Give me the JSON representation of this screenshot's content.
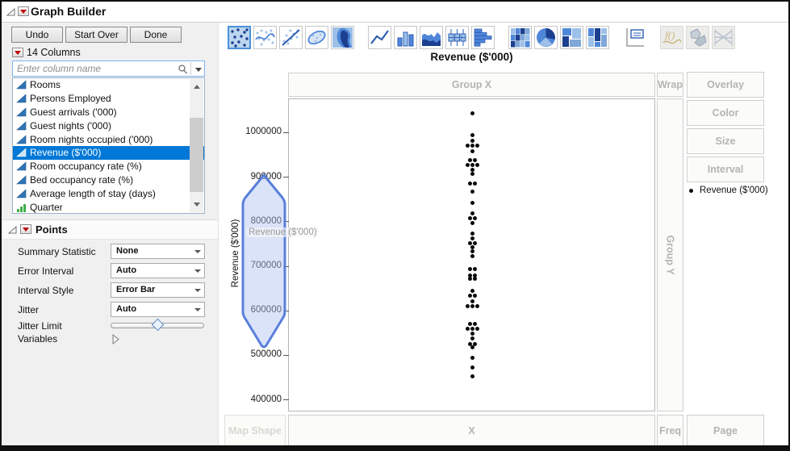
{
  "window": {
    "title": "Graph Builder"
  },
  "toolbar_buttons": {
    "undo": "Undo",
    "start_over": "Start Over",
    "done": "Done"
  },
  "columns": {
    "header": "14 Columns",
    "search_placeholder": "Enter column name",
    "items": [
      {
        "label": "Rooms",
        "type": "continuous",
        "selected": false
      },
      {
        "label": "Persons Employed",
        "type": "continuous",
        "selected": false
      },
      {
        "label": "Guest arrivals ('000)",
        "type": "continuous",
        "selected": false
      },
      {
        "label": "Guest nights ('000)",
        "type": "continuous",
        "selected": false
      },
      {
        "label": "Room nights occupied ('000)",
        "type": "continuous",
        "selected": false
      },
      {
        "label": "Revenue ($'000)",
        "type": "continuous",
        "selected": true
      },
      {
        "label": "Room occupancy rate (%)",
        "type": "continuous",
        "selected": false
      },
      {
        "label": "Bed occupancy rate (%)",
        "type": "continuous",
        "selected": false
      },
      {
        "label": "Average length of stay (days)",
        "type": "continuous",
        "selected": false
      },
      {
        "label": "Quarter",
        "type": "ordinal",
        "selected": false
      }
    ]
  },
  "points_panel": {
    "title": "Points",
    "rows": [
      {
        "label": "Summary Statistic",
        "value": "None"
      },
      {
        "label": "Error Interval",
        "value": "Auto"
      },
      {
        "label": "Interval Style",
        "value": "Error Bar"
      },
      {
        "label": "Jitter",
        "value": "Auto"
      },
      {
        "label": "Jitter Limit",
        "slider_position": 0.5
      },
      {
        "label": "Variables"
      }
    ]
  },
  "toolbar_icons": [
    {
      "name": "points",
      "selected": true
    },
    {
      "name": "smoother"
    },
    {
      "name": "line-of-fit"
    },
    {
      "name": "ellipse"
    },
    {
      "name": "contour"
    },
    {
      "name": "line"
    },
    {
      "name": "bar"
    },
    {
      "name": "area"
    },
    {
      "name": "box-plot"
    },
    {
      "name": "histogram"
    },
    {
      "name": "heatmap"
    },
    {
      "name": "pie"
    },
    {
      "name": "treemap"
    },
    {
      "name": "mosaic"
    },
    {
      "name": "caption-box",
      "plain": true
    },
    {
      "name": "formula",
      "disabled": true
    },
    {
      "name": "map-shapes",
      "disabled": true
    },
    {
      "name": "parallel",
      "disabled": true
    }
  ],
  "drop_zones": {
    "group_x": "Group X",
    "wrap": "Wrap",
    "overlay": "Overlay",
    "color": "Color",
    "size": "Size",
    "interval": "Interval",
    "group_y": "Group Y",
    "map_shape": "Map Shape",
    "x": "X",
    "freq": "Freq",
    "page": "Page"
  },
  "legend": {
    "marker": "dot",
    "label": "Revenue ($'000)"
  },
  "colors": {
    "selection_blue": "#0078d7",
    "drop_highlight_border": "#5a7fdb",
    "drop_highlight_fill": "rgba(173,193,239,0.45)",
    "icon_blue_dark": "#1c3f8f",
    "icon_blue_mid": "#4f86d9",
    "icon_blue_light": "#9dc0e8"
  },
  "chart_data": {
    "type": "scatter",
    "title": "Revenue ($'000)",
    "ylabel": "Revenue ($'000)",
    "drag_label": "Revenue ($'000)",
    "ylim": [
      373000,
      1076000
    ],
    "yticks": [
      400000,
      500000,
      600000,
      700000,
      800000,
      900000,
      1000000
    ],
    "grid": false,
    "point_format": [
      "value",
      "jitter_px"
    ],
    "points": [
      [
        1045000,
        0
      ],
      [
        995000,
        0
      ],
      [
        982000,
        0
      ],
      [
        971000,
        -6
      ],
      [
        971000,
        0
      ],
      [
        971000,
        6
      ],
      [
        960000,
        0
      ],
      [
        940000,
        -3
      ],
      [
        940000,
        3
      ],
      [
        929000,
        -6
      ],
      [
        929000,
        0
      ],
      [
        929000,
        6
      ],
      [
        918000,
        0
      ],
      [
        908000,
        0
      ],
      [
        886000,
        -3
      ],
      [
        886000,
        3
      ],
      [
        869000,
        0
      ],
      [
        844000,
        0
      ],
      [
        819000,
        0
      ],
      [
        808000,
        -3
      ],
      [
        808000,
        3
      ],
      [
        797000,
        0
      ],
      [
        775000,
        0
      ],
      [
        764000,
        0
      ],
      [
        753000,
        -3
      ],
      [
        753000,
        3
      ],
      [
        743000,
        0
      ],
      [
        735000,
        0
      ],
      [
        723000,
        0
      ],
      [
        695000,
        -3
      ],
      [
        695000,
        3
      ],
      [
        681000,
        -3
      ],
      [
        681000,
        3
      ],
      [
        672000,
        -3
      ],
      [
        672000,
        3
      ],
      [
        645000,
        0
      ],
      [
        634000,
        -3
      ],
      [
        634000,
        3
      ],
      [
        623000,
        0
      ],
      [
        612000,
        -6
      ],
      [
        612000,
        0
      ],
      [
        612000,
        6
      ],
      [
        572000,
        -3
      ],
      [
        572000,
        3
      ],
      [
        560000,
        -6
      ],
      [
        560000,
        0
      ],
      [
        560000,
        6
      ],
      [
        549000,
        0
      ],
      [
        538000,
        0
      ],
      [
        527000,
        -3
      ],
      [
        527000,
        3
      ],
      [
        518000,
        0
      ],
      [
        496000,
        0
      ],
      [
        474000,
        0
      ],
      [
        454000,
        0
      ]
    ]
  }
}
